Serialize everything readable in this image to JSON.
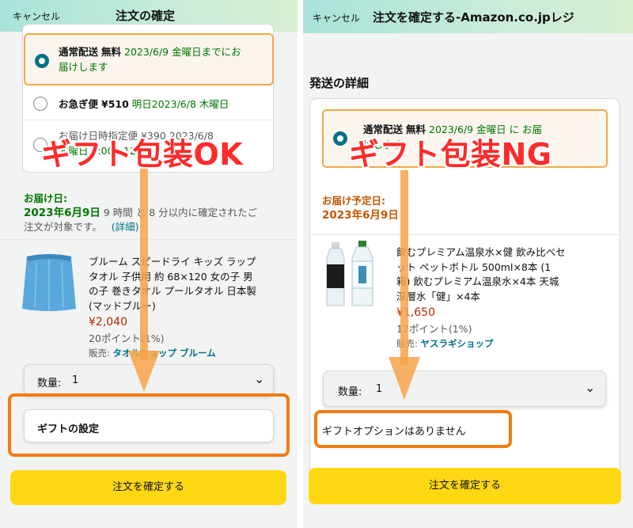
{
  "left": {
    "header": {
      "cancel": "キャンセル",
      "title": "注文の確定"
    },
    "shipping_options": [
      {
        "name": "通常配送",
        "price": "無料",
        "detail_line1": "2023/6/9 金曜日までにお",
        "detail_line2": "届けします",
        "selected": true
      },
      {
        "name": "お急ぎ便",
        "price": "¥510",
        "detail": "明日2023/6/8 木曜日",
        "selected": false
      },
      {
        "line1": "お届け日時指定便 ¥390 2023/6/8",
        "line2": "木曜日 8:00 - 12:00",
        "selected": false
      }
    ],
    "delivery": {
      "label": "お届け日:",
      "date": "2023年6月9日",
      "note_part1": "9 時間 と 8 分以内に確定されたご",
      "note_part2": "注文が対象です。",
      "details_link": "(詳細)"
    },
    "product": {
      "title_lines": [
        "ブルーム スピードライ キッズ ラップ",
        "タオル 子供用 約 68×120 女の子 男",
        "の子 巻きタオル プールタオル 日本製",
        "(マッドブルー)"
      ],
      "price": "¥2,040",
      "points": "20ポイント(1%)",
      "seller_label": "販売:",
      "seller": "タオルショップ ブルーム"
    },
    "quantity": {
      "label": "数量:",
      "value": "1"
    },
    "gift_button": "ギフトの設定",
    "confirm_button": "注文を確定する",
    "overlay": "ギフト包装OK"
  },
  "right": {
    "header": {
      "cancel": "キャンセル",
      "title": "注文を確定する-Amazon.co.jpレジ"
    },
    "section_title": "発送の詳細",
    "shipping_option": {
      "name": "通常配送",
      "price": "無料",
      "detail_line1": "2023/6/9 金曜日 に お届",
      "detail_line2": "けします",
      "selected": true
    },
    "delivery": {
      "label": "お届け予定日:",
      "date": "2023年6月9日"
    },
    "product": {
      "title_lines": [
        "飲むプレミアム温泉水×健 飲み比べセ",
        "ット ペットボトル 500ml×8本 (1",
        "箱) 飲むプレミアム温泉水×4本 天城",
        "深層水「健」×4本"
      ],
      "price": "¥1,650",
      "points": "17ポイント(1%)",
      "seller_label": "販売:",
      "seller": "ヤスラギショップ"
    },
    "quantity": {
      "label": "数量:",
      "value": "1"
    },
    "gift_note": "ギフトオプションはありません",
    "confirm_button": "注文を確定する",
    "overlay": "ギフト包装NG"
  },
  "colors": {
    "accent_orange": "#f47b0f",
    "overlay_red": "#ff2a2a",
    "button_yellow": "#ffd814",
    "link_teal": "#007185",
    "green": "#007600"
  }
}
